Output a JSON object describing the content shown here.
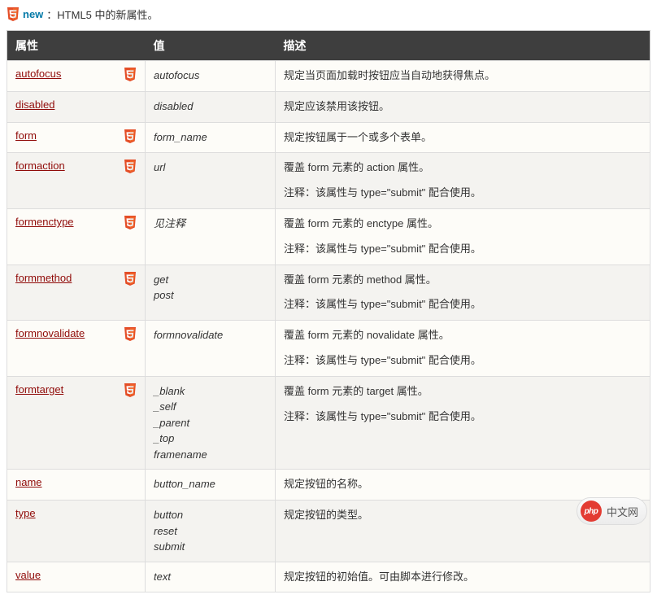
{
  "note": {
    "new_label": "new",
    "text": "：HTML5 中的新属性。"
  },
  "headers": {
    "attr": "属性",
    "val": "值",
    "desc": "描述"
  },
  "rows": [
    {
      "name": "autofocus",
      "html5": true,
      "values": [
        "autofocus"
      ],
      "desc": [
        "规定当页面加载时按钮应当自动地获得焦点。"
      ]
    },
    {
      "name": "disabled",
      "html5": false,
      "values": [
        "disabled"
      ],
      "desc": [
        "规定应该禁用该按钮。"
      ]
    },
    {
      "name": "form",
      "html5": true,
      "values": [
        "form_name"
      ],
      "desc": [
        "规定按钮属于一个或多个表单。"
      ]
    },
    {
      "name": "formaction",
      "html5": true,
      "values": [
        "url"
      ],
      "desc": [
        "覆盖 form 元素的 action 属性。",
        "注释：该属性与 type=\"submit\" 配合使用。"
      ]
    },
    {
      "name": "formenctype",
      "html5": true,
      "values": [
        "见注释"
      ],
      "desc": [
        "覆盖 form 元素的 enctype 属性。",
        "注释：该属性与 type=\"submit\" 配合使用。"
      ]
    },
    {
      "name": "formmethod",
      "html5": true,
      "values": [
        "get",
        "post"
      ],
      "desc": [
        "覆盖 form 元素的 method 属性。",
        "注释：该属性与 type=\"submit\" 配合使用。"
      ]
    },
    {
      "name": "formnovalidate",
      "html5": true,
      "values": [
        "formnovalidate"
      ],
      "desc": [
        "覆盖 form 元素的 novalidate 属性。",
        "注释：该属性与 type=\"submit\" 配合使用。"
      ]
    },
    {
      "name": "formtarget",
      "html5": true,
      "values": [
        "_blank",
        "_self",
        "_parent",
        "_top",
        "framename"
      ],
      "desc": [
        "覆盖 form 元素的 target 属性。",
        "注释：该属性与 type=\"submit\" 配合使用。"
      ]
    },
    {
      "name": "name",
      "html5": false,
      "values": [
        "button_name"
      ],
      "desc": [
        "规定按钮的名称。"
      ]
    },
    {
      "name": "type",
      "html5": false,
      "values": [
        "button",
        "reset",
        "submit"
      ],
      "desc": [
        "规定按钮的类型。"
      ]
    },
    {
      "name": "value",
      "html5": false,
      "values": [
        "text"
      ],
      "desc": [
        "规定按钮的初始值。可由脚本进行修改。"
      ]
    }
  ],
  "watermark": {
    "brand": "php",
    "text": "中文网"
  }
}
